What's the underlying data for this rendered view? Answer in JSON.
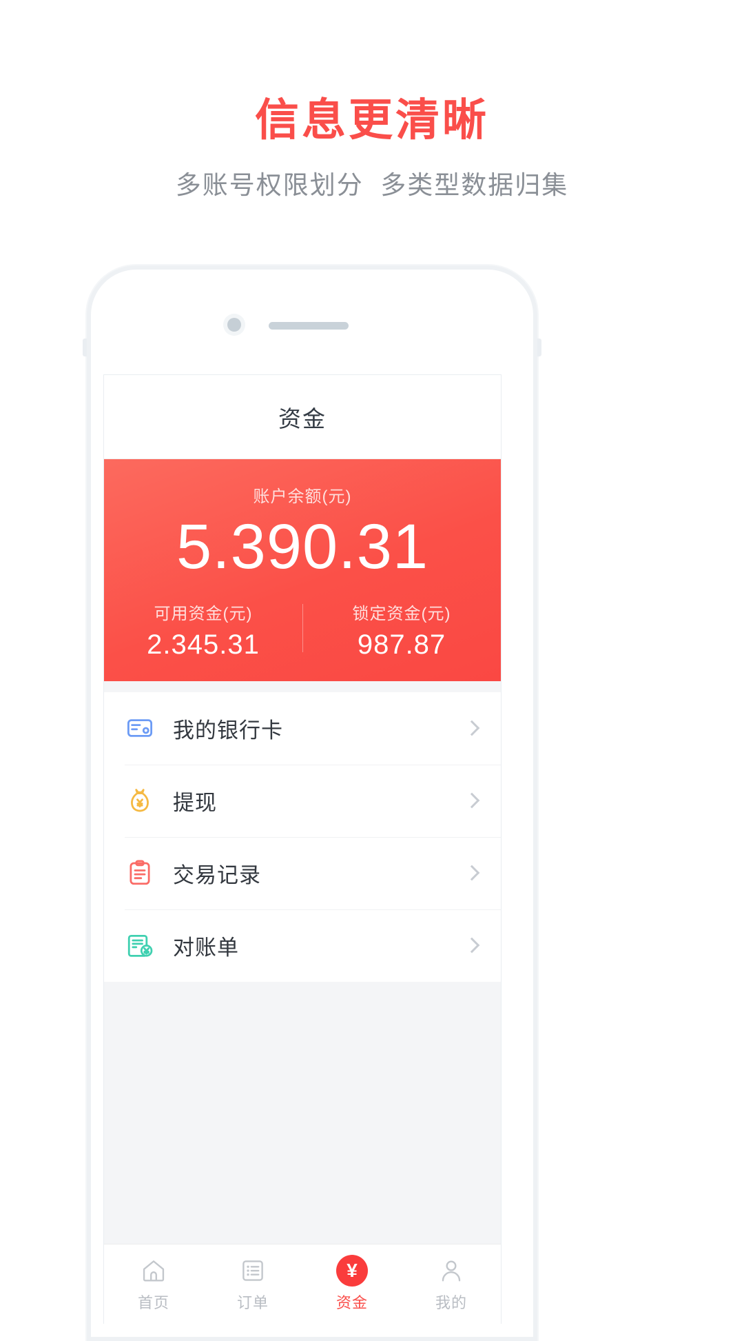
{
  "promo": {
    "title": "信息更清晰",
    "subtitle": "多账号权限划分  多类型数据归集",
    "accent_color": "#fa4e4a",
    "subtitle_color": "#8a8f96"
  },
  "phone": {
    "camera_icon": "camera-dot-icon",
    "speaker_icon": "earpiece-speaker-icon"
  },
  "app": {
    "header": {
      "title": "资金"
    },
    "balance_card": {
      "label": "账户余额(元)",
      "amount": "5.390.31",
      "background_color": "#fa4e4a",
      "columns": [
        {
          "label": "可用资金(元)",
          "value": "2.345.31"
        },
        {
          "label": "锁定资金(元)",
          "value": "987.87"
        }
      ]
    },
    "menu": [
      {
        "label": "我的银行卡",
        "icon": "bank-card-icon",
        "icon_color": "#6c9bf5",
        "chevron": "chevron-right-icon"
      },
      {
        "label": "提现",
        "icon": "money-bag-icon",
        "icon_color": "#f5b942",
        "chevron": "chevron-right-icon"
      },
      {
        "label": "交易记录",
        "icon": "clipboard-list-icon",
        "icon_color": "#fa6b66",
        "chevron": "chevron-right-icon"
      },
      {
        "label": "对账单",
        "icon": "statement-doc-icon",
        "icon_color": "#3fd0b0",
        "chevron": "chevron-right-icon"
      }
    ],
    "tabbar": {
      "active_color": "#fa4e4a",
      "inactive_color": "#b9bdc3",
      "tabs": [
        {
          "label": "首页",
          "icon": "home-icon",
          "active": false
        },
        {
          "label": "订单",
          "icon": "order-list-icon",
          "active": false
        },
        {
          "label": "资金",
          "icon": "yen-funds-icon",
          "active": true,
          "badge_text": "¥"
        },
        {
          "label": "我的",
          "icon": "user-profile-icon",
          "active": false
        }
      ]
    }
  }
}
